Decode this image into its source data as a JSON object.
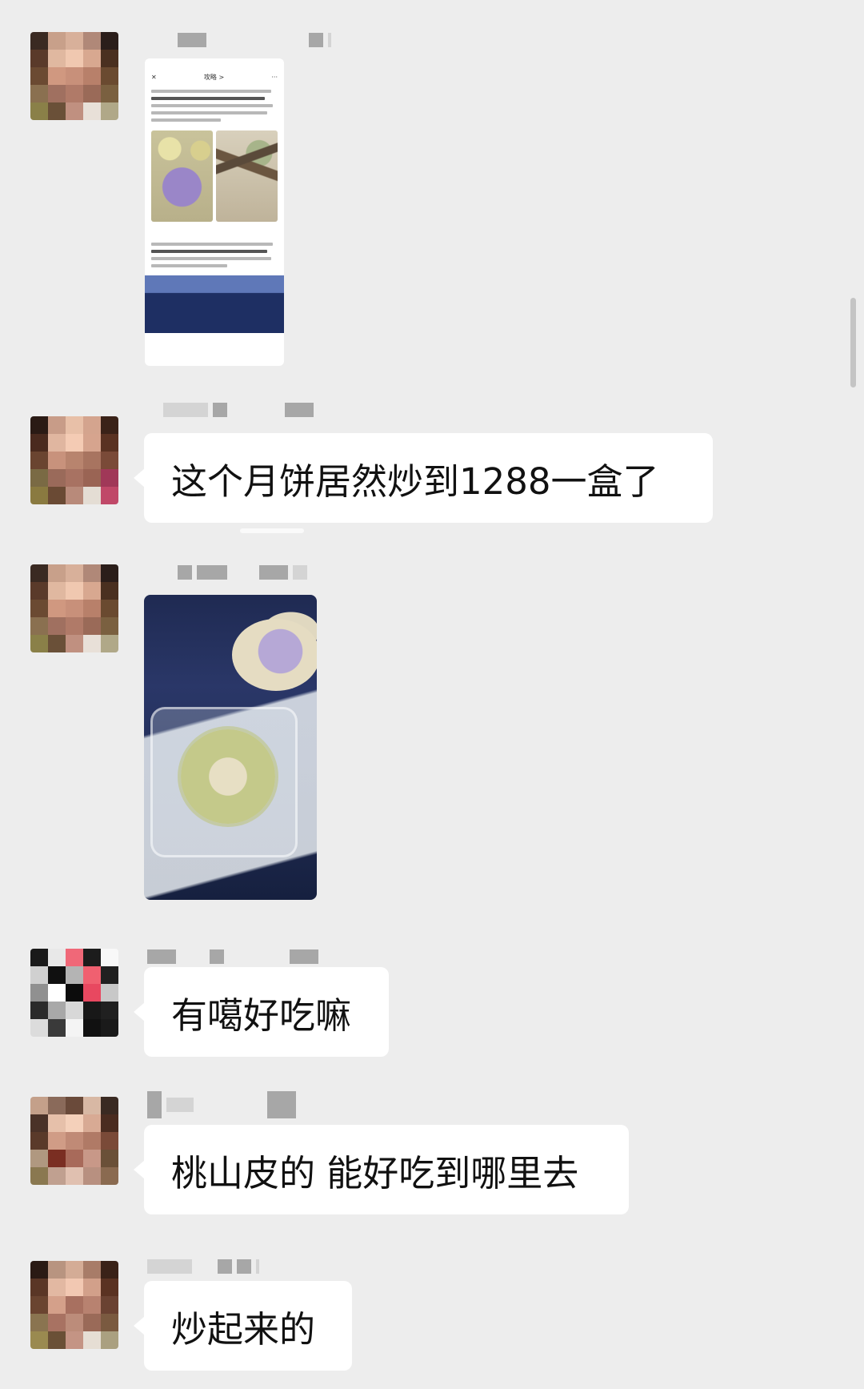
{
  "chat": {
    "messages": [
      {
        "type": "image",
        "kind": "article-screenshot",
        "thumb": {
          "nav_title": "攻略 >"
        }
      },
      {
        "type": "text",
        "text": "这个月饼居然炒到1288一盒了"
      },
      {
        "type": "image",
        "kind": "photo"
      },
      {
        "type": "text",
        "text": "有噶好吃嘛"
      },
      {
        "type": "text",
        "text": "桃山皮的 能好吃到哪里去"
      },
      {
        "type": "text",
        "text": "炒起来的"
      }
    ]
  },
  "icons": {
    "close": "close-icon",
    "more": "more-icon"
  },
  "colors": {
    "background": "#ededed",
    "bubble": "#ffffff",
    "text": "#111111"
  }
}
